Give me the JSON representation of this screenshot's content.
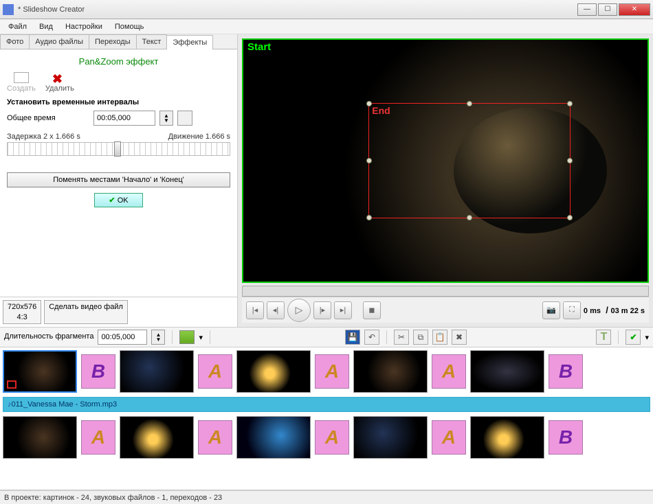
{
  "window": {
    "title": "* Slideshow Creator"
  },
  "menu": {
    "file": "Файл",
    "view": "Вид",
    "settings": "Настройки",
    "help": "Помощь"
  },
  "tabs": {
    "photo": "Фото",
    "audio": "Аудио файлы",
    "transitions": "Переходы",
    "text": "Текст",
    "effects": "Эффекты"
  },
  "effects": {
    "title": "Pan&Zoom эффект",
    "create": "Создать",
    "delete": "Удалить",
    "section": "Установить временные интервалы",
    "total_time_label": "Общее время",
    "total_time_value": "00:05,000",
    "delay_label": "Задержка 2 x 1.666 s",
    "motion_label": "Движение 1.666 s",
    "swap_btn": "Поменять местами 'Начало' и 'Конец'",
    "ok": "OK"
  },
  "left_footer": {
    "resolution": "720x576",
    "aspect": "4:3",
    "make_video": "Сделать видео файл"
  },
  "preview": {
    "start": "Start",
    "end": "End"
  },
  "playback": {
    "time_current": "0 ms",
    "time_total": "03 m 22 s"
  },
  "timeline_toolbar": {
    "duration_label": "Длительность фрагмента",
    "duration_value": "00:05,000"
  },
  "timeline": {
    "audio_track": "011_Vanessa Mae - Storm.mp3",
    "trans_letters": [
      "B",
      "A",
      "A",
      "A",
      "B",
      "A",
      "A",
      "A",
      "A",
      "B"
    ]
  },
  "status": "В проекте: картинок - 24, звуковых файлов - 1, переходов - 23"
}
